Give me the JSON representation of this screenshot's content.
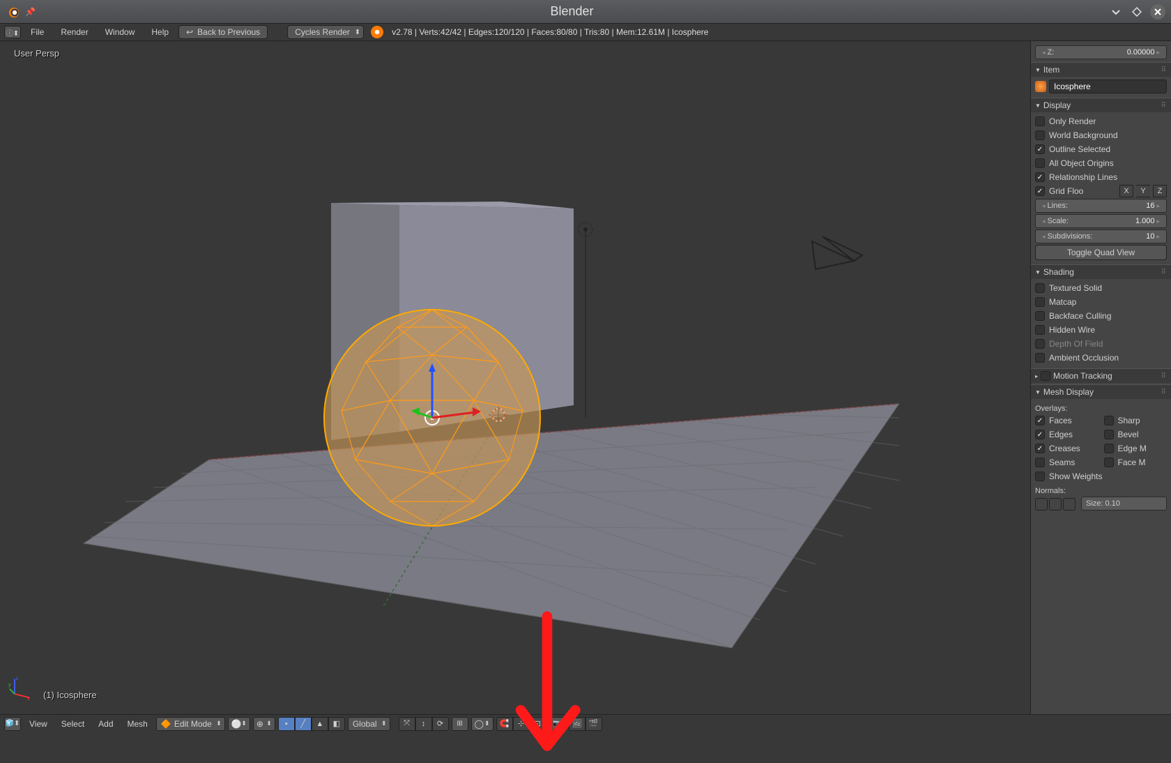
{
  "titlebar": {
    "title": "Blender"
  },
  "infobar": {
    "menus": [
      "File",
      "Render",
      "Window",
      "Help"
    ],
    "back_label": "Back to Previous",
    "engine": "Cycles Render",
    "stats": "v2.78 | Verts:42/42 | Edges:120/120 | Faces:80/80 | Tris:80 | Mem:12.61M | Icosphere"
  },
  "viewport": {
    "persp": "User Persp",
    "object_label": "(1) Icosphere"
  },
  "panel": {
    "transform_z": {
      "label": "Z:",
      "value": "0.00000"
    },
    "item": {
      "header": "Item",
      "name": "Icosphere"
    },
    "display": {
      "header": "Display",
      "only_render": "Only Render",
      "world_bg": "World Background",
      "outline_sel": "Outline Selected",
      "all_origins": "All Object Origins",
      "rel_lines": "Relationship Lines",
      "grid_floor": "Grid Floo",
      "axes": [
        "X",
        "Y",
        "Z"
      ],
      "lines": {
        "label": "Lines:",
        "value": "16"
      },
      "scale": {
        "label": "Scale:",
        "value": "1.000"
      },
      "subdiv": {
        "label": "Subdivisions:",
        "value": "10"
      },
      "toggle_quad": "Toggle Quad View"
    },
    "shading": {
      "header": "Shading",
      "textured": "Textured Solid",
      "matcap": "Matcap",
      "backface": "Backface Culling",
      "hidden_wire": "Hidden Wire",
      "dof": "Depth Of Field",
      "ao": "Ambient Occlusion"
    },
    "motion": {
      "header": "Motion Tracking"
    },
    "mesh_display": {
      "header": "Mesh Display",
      "overlays": "Overlays:",
      "faces": "Faces",
      "sharp": "Sharp",
      "edges": "Edges",
      "bevel": "Bevel",
      "creases": "Creases",
      "edgem": "Edge M",
      "seams": "Seams",
      "facem": "Face M",
      "show_weights": "Show Weights",
      "normals": "Normals:",
      "size": "Size: 0.10"
    }
  },
  "view_header": {
    "menus": [
      "View",
      "Select",
      "Add",
      "Mesh"
    ],
    "mode": "Edit Mode",
    "orientation": "Global"
  }
}
